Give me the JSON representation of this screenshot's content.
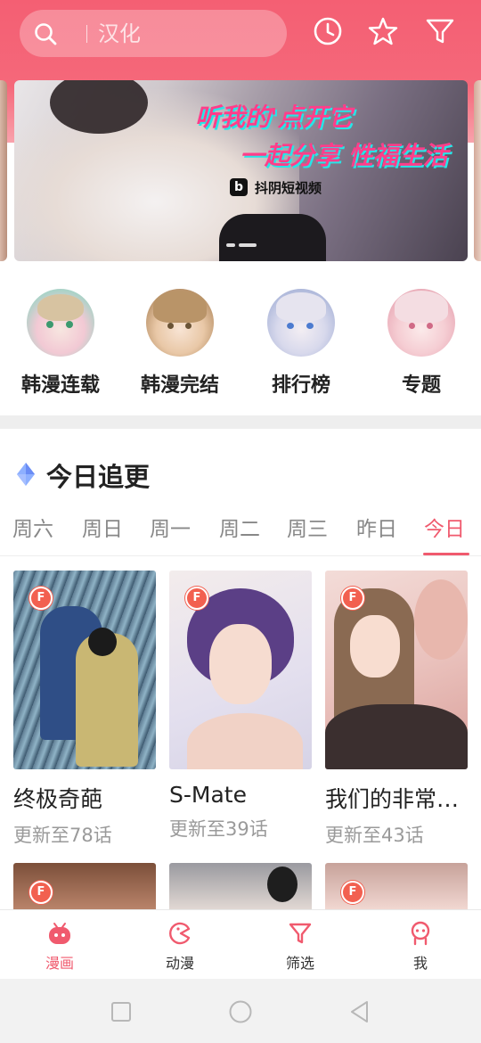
{
  "search": {
    "placeholder": "汉化"
  },
  "header_icons": [
    "history-icon",
    "favorite-star-icon",
    "filter-icon"
  ],
  "banner": {
    "headline_line1": "听我的'点开它",
    "headline_line2": "一起分享 性福生活",
    "brand_logo": "b",
    "brand_name": "抖阴短视频",
    "page_count": 2,
    "active_page": 2
  },
  "categories": [
    {
      "label": "韩漫连载"
    },
    {
      "label": "韩漫完结"
    },
    {
      "label": "排行榜"
    },
    {
      "label": "专题"
    }
  ],
  "section": {
    "title": "今日追更"
  },
  "days": [
    "周六",
    "周日",
    "周一",
    "周二",
    "周三",
    "昨日",
    "今日"
  ],
  "active_day": "今日",
  "comics": [
    {
      "title": "终极奇葩",
      "update": "更新至78话",
      "badge": "F"
    },
    {
      "title": "S-Mate",
      "update": "更新至39话",
      "badge": "F"
    },
    {
      "title": "我们的非常…",
      "update": "更新至43话",
      "badge": "F"
    }
  ],
  "comics_row2_badges": [
    "F",
    "",
    "F"
  ],
  "bottom_nav": [
    {
      "label": "漫画",
      "icon": "comic-icon",
      "active": true
    },
    {
      "label": "动漫",
      "icon": "anime-icon",
      "active": false
    },
    {
      "label": "筛选",
      "icon": "filter-icon",
      "active": false
    },
    {
      "label": "我",
      "icon": "profile-icon",
      "active": false
    }
  ],
  "colors": {
    "accent": "#f05a6e",
    "header": "#f45f73",
    "badge": "#f26050"
  }
}
